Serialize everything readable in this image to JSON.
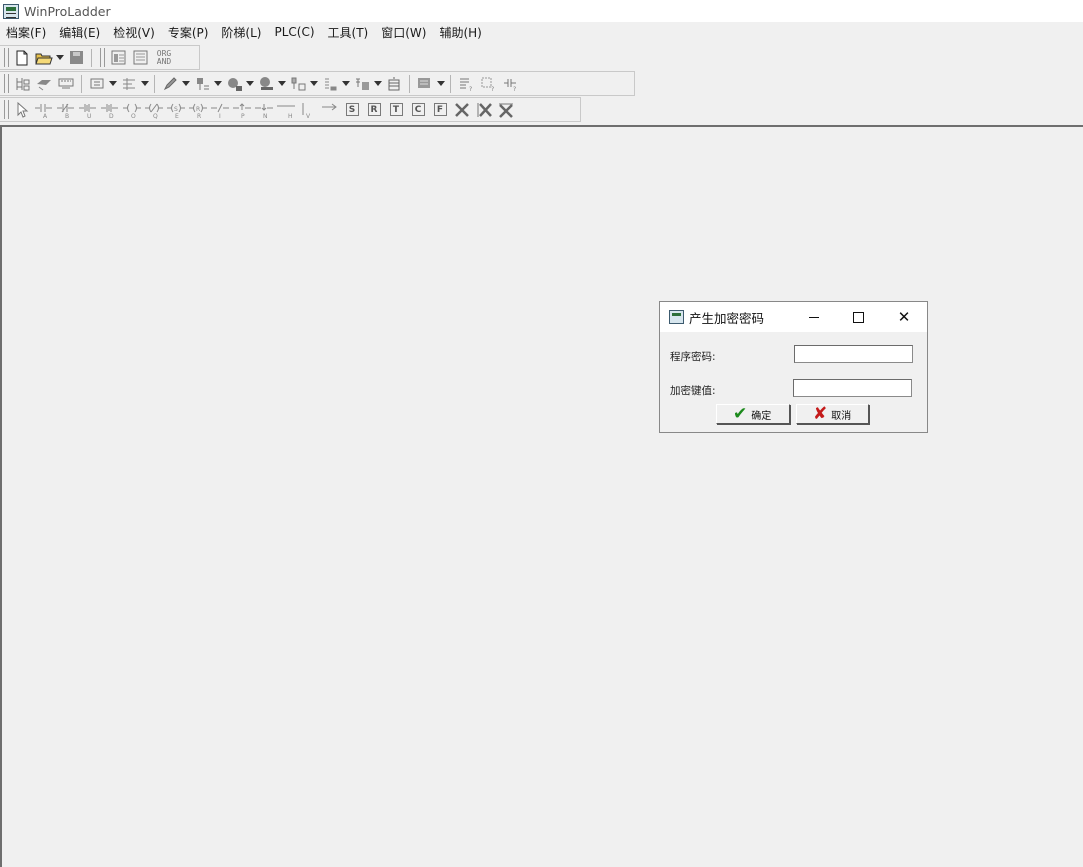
{
  "window": {
    "title": "WinProLadder"
  },
  "menu": [
    {
      "label": "档案(F)"
    },
    {
      "label": "编辑(E)"
    },
    {
      "label": "检视(V)"
    },
    {
      "label": "专案(P)"
    },
    {
      "label": "阶梯(L)"
    },
    {
      "label": "PLC(C)"
    },
    {
      "label": "工具(T)"
    },
    {
      "label": "窗口(W)"
    },
    {
      "label": "辅助(H)"
    }
  ],
  "toolbar1": {
    "org_and_top": "ORG",
    "org_and_bottom": "AND"
  },
  "toolbar3": {
    "letters": [
      "A",
      "B",
      "U",
      "D",
      "O",
      "Q",
      "E",
      "R",
      "I",
      "P",
      "N",
      "H",
      "V"
    ],
    "box_letters": [
      "S",
      "R",
      "T",
      "C",
      "F"
    ]
  },
  "dialog": {
    "title": "产生加密密码",
    "program_password_label": "程序密码:",
    "program_password_value": "",
    "encrypt_key_label": "加密键值:",
    "encrypt_key_value": "",
    "ok_label": "确定",
    "cancel_label": "取消"
  }
}
